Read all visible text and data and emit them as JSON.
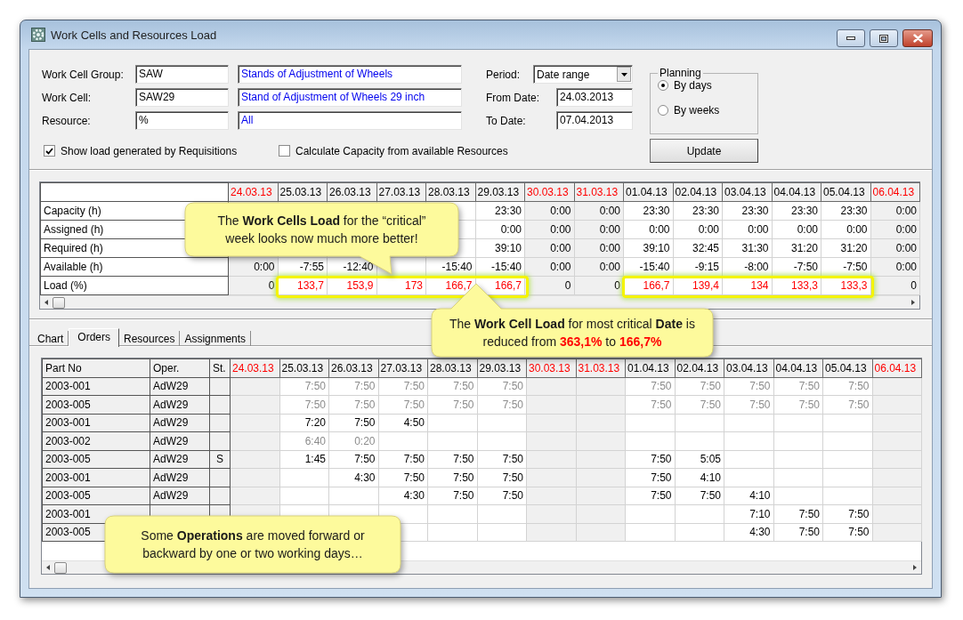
{
  "window": {
    "title": "Work Cells and Resources Load"
  },
  "filters": {
    "fields": [
      {
        "label": "Work Cell Group:",
        "code": "SAW",
        "description": "Stands of Adjustment of Wheels"
      },
      {
        "label": "Work Cell:",
        "code": "SAW29",
        "description": "Stand of Adjustment of Wheels 29 inch"
      },
      {
        "label": "Resource:",
        "code": "%",
        "description": "All"
      }
    ],
    "period": {
      "label": "Period:",
      "value": "Date range"
    },
    "from_date": {
      "label": "From Date:",
      "value": "24.03.2013"
    },
    "to_date": {
      "label": "To Date:",
      "value": "07.04.2013"
    },
    "checkboxes": [
      {
        "label": "Show load generated by Requisitions",
        "checked": true
      },
      {
        "label": "Calculate Capacity from available Resources",
        "checked": false
      }
    ],
    "planning": {
      "title": "Planning",
      "options": [
        {
          "label": "By days",
          "selected": true
        },
        {
          "label": "By weeks",
          "selected": false
        }
      ]
    },
    "update_button": "Update"
  },
  "load_grid": {
    "columns": [
      {
        "label": "24.03.13",
        "weekend": true
      },
      {
        "label": "25.03.13",
        "weekend": false
      },
      {
        "label": "26.03.13",
        "weekend": false
      },
      {
        "label": "27.03.13",
        "weekend": false
      },
      {
        "label": "28.03.13",
        "weekend": false
      },
      {
        "label": "29.03.13",
        "weekend": false
      },
      {
        "label": "30.03.13",
        "weekend": true
      },
      {
        "label": "31.03.13",
        "weekend": true
      },
      {
        "label": "01.04.13",
        "weekend": false
      },
      {
        "label": "02.04.13",
        "weekend": false
      },
      {
        "label": "03.04.13",
        "weekend": false
      },
      {
        "label": "04.04.13",
        "weekend": false
      },
      {
        "label": "05.04.13",
        "weekend": false
      },
      {
        "label": "06.04.13",
        "weekend": true
      }
    ],
    "rows": [
      {
        "label": "Capacity (h)",
        "values": [
          {
            "kind": "blank"
          },
          {
            "kind": "blank"
          },
          {
            "kind": "blank"
          },
          {
            "kind": "blank"
          },
          {
            "kind": "blank"
          },
          {
            "kind": "value",
            "text": "23:30"
          },
          {
            "kind": "value",
            "text": "0:00"
          },
          {
            "kind": "value",
            "text": "0:00"
          },
          {
            "kind": "value",
            "text": "23:30"
          },
          {
            "kind": "value",
            "text": "23:30"
          },
          {
            "kind": "value",
            "text": "23:30"
          },
          {
            "kind": "value",
            "text": "23:30"
          },
          {
            "kind": "value",
            "text": "23:30"
          },
          {
            "kind": "value",
            "text": "0:00"
          }
        ]
      },
      {
        "label": "Assigned (h)",
        "values": [
          {
            "kind": "blank"
          },
          {
            "kind": "blank"
          },
          {
            "kind": "blank"
          },
          {
            "kind": "blank"
          },
          {
            "kind": "blank"
          },
          {
            "kind": "value",
            "text": "0:00"
          },
          {
            "kind": "value",
            "text": "0:00"
          },
          {
            "kind": "value",
            "text": "0:00"
          },
          {
            "kind": "value",
            "text": "0:00"
          },
          {
            "kind": "value",
            "text": "0:00"
          },
          {
            "kind": "value",
            "text": "0:00"
          },
          {
            "kind": "value",
            "text": "0:00"
          },
          {
            "kind": "value",
            "text": "0:00"
          },
          {
            "kind": "value",
            "text": "0:00"
          }
        ]
      },
      {
        "label": "Required (h)",
        "values": [
          {
            "kind": "blank"
          },
          {
            "kind": "blank"
          },
          {
            "kind": "blank"
          },
          {
            "kind": "blank"
          },
          {
            "kind": "blank"
          },
          {
            "kind": "value",
            "text": "39:10"
          },
          {
            "kind": "value",
            "text": "0:00"
          },
          {
            "kind": "value",
            "text": "0:00"
          },
          {
            "kind": "value",
            "text": "39:10"
          },
          {
            "kind": "value",
            "text": "32:45"
          },
          {
            "kind": "value",
            "text": "31:30"
          },
          {
            "kind": "value",
            "text": "31:20"
          },
          {
            "kind": "value",
            "text": "31:20"
          },
          {
            "kind": "value",
            "text": "0:00"
          }
        ]
      },
      {
        "label": "Available (h)",
        "values": [
          {
            "kind": "value",
            "text": "0:00"
          },
          {
            "kind": "value",
            "text": "-7:55"
          },
          {
            "kind": "value",
            "text": "-12:40"
          },
          {
            "kind": "blank"
          },
          {
            "kind": "value",
            "text": "-15:40"
          },
          {
            "kind": "value",
            "text": "-15:40"
          },
          {
            "kind": "value",
            "text": "0:00"
          },
          {
            "kind": "value",
            "text": "0:00"
          },
          {
            "kind": "value",
            "text": "-15:40"
          },
          {
            "kind": "value",
            "text": "-9:15"
          },
          {
            "kind": "value",
            "text": "-8:00"
          },
          {
            "kind": "value",
            "text": "-7:50"
          },
          {
            "kind": "value",
            "text": "-7:50"
          },
          {
            "kind": "value",
            "text": "0:00"
          }
        ]
      },
      {
        "label": "Load (%)",
        "values": [
          {
            "kind": "value",
            "text": "0",
            "over": false,
            "framed": false
          },
          {
            "kind": "value",
            "text": "133,7",
            "over": true,
            "framed": true
          },
          {
            "kind": "value",
            "text": "153,9",
            "over": true,
            "framed": true
          },
          {
            "kind": "value",
            "text": "173",
            "over": true,
            "framed": true
          },
          {
            "kind": "value",
            "text": "166,7",
            "over": true,
            "framed": true
          },
          {
            "kind": "value",
            "text": "166,7",
            "over": true,
            "framed": true
          },
          {
            "kind": "value",
            "text": "0",
            "over": false,
            "framed": false
          },
          {
            "kind": "value",
            "text": "0",
            "over": false,
            "framed": false
          },
          {
            "kind": "value",
            "text": "166,7",
            "over": true,
            "framed": true
          },
          {
            "kind": "value",
            "text": "139,4",
            "over": true,
            "framed": true
          },
          {
            "kind": "value",
            "text": "134",
            "over": true,
            "framed": true
          },
          {
            "kind": "value",
            "text": "133,3",
            "over": true,
            "framed": true
          },
          {
            "kind": "value",
            "text": "133,3",
            "over": true,
            "framed": true
          },
          {
            "kind": "value",
            "text": "0",
            "over": false,
            "framed": false
          }
        ]
      }
    ]
  },
  "tabs": [
    {
      "label": "Chart",
      "selected": false
    },
    {
      "label": "Orders",
      "selected": true
    },
    {
      "label": "Resources",
      "selected": false
    },
    {
      "label": "Assignments",
      "selected": false
    }
  ],
  "orders_grid": {
    "headers": [
      "Part No",
      "Oper.",
      "St."
    ],
    "columns": [
      {
        "label": "24.03.13",
        "weekend": true
      },
      {
        "label": "25.03.13",
        "weekend": false
      },
      {
        "label": "26.03.13",
        "weekend": false
      },
      {
        "label": "27.03.13",
        "weekend": false
      },
      {
        "label": "28.03.13",
        "weekend": false
      },
      {
        "label": "29.03.13",
        "weekend": false
      },
      {
        "label": "30.03.13",
        "weekend": true
      },
      {
        "label": "31.03.13",
        "weekend": true
      },
      {
        "label": "01.04.13",
        "weekend": false
      },
      {
        "label": "02.04.13",
        "weekend": false
      },
      {
        "label": "03.04.13",
        "weekend": false
      },
      {
        "label": "04.04.13",
        "weekend": false
      },
      {
        "label": "05.04.13",
        "weekend": false
      },
      {
        "label": "06.04.13",
        "weekend": true
      }
    ],
    "rows": [
      {
        "part_no": "2003-001",
        "oper": "AdW29",
        "greyed": true,
        "values": [
          {
            "kind": "blank"
          },
          {
            "kind": "value",
            "text": "7:50"
          },
          {
            "kind": "value",
            "text": "7:50"
          },
          {
            "kind": "value",
            "text": "7:50"
          },
          {
            "kind": "value",
            "text": "7:50"
          },
          {
            "kind": "value",
            "text": "7:50"
          },
          {
            "kind": "blank"
          },
          {
            "kind": "blank"
          },
          {
            "kind": "value",
            "text": "7:50"
          },
          {
            "kind": "value",
            "text": "7:50"
          },
          {
            "kind": "value",
            "text": "7:50"
          },
          {
            "kind": "value",
            "text": "7:50"
          },
          {
            "kind": "value",
            "text": "7:50"
          },
          {
            "kind": "blank"
          }
        ]
      },
      {
        "part_no": "2003-005",
        "oper": "AdW29",
        "greyed": true,
        "values": [
          {
            "kind": "blank"
          },
          {
            "kind": "value",
            "text": "7:50"
          },
          {
            "kind": "value",
            "text": "7:50"
          },
          {
            "kind": "value",
            "text": "7:50"
          },
          {
            "kind": "value",
            "text": "7:50"
          },
          {
            "kind": "value",
            "text": "7:50"
          },
          {
            "kind": "blank"
          },
          {
            "kind": "blank"
          },
          {
            "kind": "value",
            "text": "7:50"
          },
          {
            "kind": "value",
            "text": "7:50"
          },
          {
            "kind": "value",
            "text": "7:50"
          },
          {
            "kind": "value",
            "text": "7:50"
          },
          {
            "kind": "value",
            "text": "7:50"
          },
          {
            "kind": "blank"
          }
        ]
      },
      {
        "part_no": "2003-001",
        "oper": "AdW29",
        "greyed": false,
        "values": [
          {
            "kind": "blank"
          },
          {
            "kind": "value",
            "text": "7:20"
          },
          {
            "kind": "value",
            "text": "7:50"
          },
          {
            "kind": "value",
            "text": "4:50"
          },
          {
            "kind": "blank"
          },
          {
            "kind": "blank"
          },
          {
            "kind": "blank"
          },
          {
            "kind": "blank"
          },
          {
            "kind": "blank"
          },
          {
            "kind": "blank"
          },
          {
            "kind": "blank"
          },
          {
            "kind": "blank"
          },
          {
            "kind": "blank"
          },
          {
            "kind": "blank"
          }
        ]
      },
      {
        "part_no": "2003-002",
        "oper": "AdW29",
        "greyed": true,
        "values": [
          {
            "kind": "blank"
          },
          {
            "kind": "value",
            "text": "6:40"
          },
          {
            "kind": "value",
            "text": "0:20"
          },
          {
            "kind": "blank"
          },
          {
            "kind": "blank"
          },
          {
            "kind": "blank"
          },
          {
            "kind": "blank"
          },
          {
            "kind": "blank"
          },
          {
            "kind": "blank"
          },
          {
            "kind": "blank"
          },
          {
            "kind": "blank"
          },
          {
            "kind": "blank"
          },
          {
            "kind": "blank"
          },
          {
            "kind": "blank"
          }
        ]
      },
      {
        "part_no": "2003-005",
        "oper": "AdW29",
        "st": "S",
        "greyed": false,
        "values": [
          {
            "kind": "blank"
          },
          {
            "kind": "value",
            "text": "1:45"
          },
          {
            "kind": "value",
            "text": "7:50"
          },
          {
            "kind": "value",
            "text": "7:50"
          },
          {
            "kind": "value",
            "text": "7:50"
          },
          {
            "kind": "value",
            "text": "7:50"
          },
          {
            "kind": "blank"
          },
          {
            "kind": "blank"
          },
          {
            "kind": "value",
            "text": "7:50"
          },
          {
            "kind": "value",
            "text": "5:05"
          },
          {
            "kind": "blank"
          },
          {
            "kind": "blank"
          },
          {
            "kind": "blank"
          },
          {
            "kind": "blank"
          }
        ]
      },
      {
        "part_no": "2003-001",
        "oper": "AdW29",
        "greyed": false,
        "values": [
          {
            "kind": "blank"
          },
          {
            "kind": "blank"
          },
          {
            "kind": "value",
            "text": "4:30"
          },
          {
            "kind": "value",
            "text": "7:50"
          },
          {
            "kind": "value",
            "text": "7:50"
          },
          {
            "kind": "value",
            "text": "7:50"
          },
          {
            "kind": "blank"
          },
          {
            "kind": "blank"
          },
          {
            "kind": "value",
            "text": "7:50"
          },
          {
            "kind": "value",
            "text": "4:10"
          },
          {
            "kind": "blank"
          },
          {
            "kind": "blank"
          },
          {
            "kind": "blank"
          },
          {
            "kind": "blank"
          }
        ]
      },
      {
        "part_no": "2003-005",
        "oper": "AdW29",
        "greyed": false,
        "values": [
          {
            "kind": "blank"
          },
          {
            "kind": "blank"
          },
          {
            "kind": "blank"
          },
          {
            "kind": "value",
            "text": "4:30"
          },
          {
            "kind": "value",
            "text": "7:50"
          },
          {
            "kind": "value",
            "text": "7:50"
          },
          {
            "kind": "blank"
          },
          {
            "kind": "blank"
          },
          {
            "kind": "value",
            "text": "7:50"
          },
          {
            "kind": "value",
            "text": "7:50"
          },
          {
            "kind": "value",
            "text": "4:10"
          },
          {
            "kind": "blank"
          },
          {
            "kind": "blank"
          },
          {
            "kind": "blank"
          }
        ]
      },
      {
        "part_no": "2003-001",
        "greyed": false,
        "values": [
          {
            "kind": "blank"
          },
          {
            "kind": "blank"
          },
          {
            "kind": "blank"
          },
          {
            "kind": "blank"
          },
          {
            "kind": "blank"
          },
          {
            "kind": "blank"
          },
          {
            "kind": "blank"
          },
          {
            "kind": "blank"
          },
          {
            "kind": "blank"
          },
          {
            "kind": "blank"
          },
          {
            "kind": "value",
            "text": "7:10"
          },
          {
            "kind": "value",
            "text": "7:50"
          },
          {
            "kind": "value",
            "text": "7:50"
          },
          {
            "kind": "blank"
          }
        ]
      },
      {
        "part_no": "2003-005",
        "greyed": false,
        "values": [
          {
            "kind": "blank"
          },
          {
            "kind": "blank"
          },
          {
            "kind": "blank"
          },
          {
            "kind": "blank"
          },
          {
            "kind": "blank"
          },
          {
            "kind": "blank"
          },
          {
            "kind": "blank"
          },
          {
            "kind": "blank"
          },
          {
            "kind": "blank"
          },
          {
            "kind": "blank"
          },
          {
            "kind": "value",
            "text": "4:30"
          },
          {
            "kind": "value",
            "text": "7:50"
          },
          {
            "kind": "value",
            "text": "7:50"
          },
          {
            "kind": "blank"
          }
        ]
      }
    ]
  },
  "callouts": [
    {
      "segments": [
        {
          "text": "The ",
          "kind": "plain"
        },
        {
          "text": "Work Cells Load",
          "kind": "strong"
        },
        {
          "text": " for the “critical” week looks now much more better!",
          "kind": "plain"
        }
      ]
    },
    {
      "segments": [
        {
          "text": "The ",
          "kind": "plain"
        },
        {
          "text": "Work Cell Load",
          "kind": "strong"
        },
        {
          "text": " for most critical ",
          "kind": "plain"
        },
        {
          "text": "Date",
          "kind": "strong"
        },
        {
          "text": " is reduced from ",
          "kind": "plain"
        },
        {
          "text": "363,1%",
          "kind": "alert"
        },
        {
          "text": " to ",
          "kind": "plain"
        },
        {
          "text": "166,7%",
          "kind": "alert"
        }
      ]
    },
    {
      "segments": [
        {
          "text": "Some ",
          "kind": "plain"
        },
        {
          "text": "Operations",
          "kind": "strong"
        },
        {
          "text": " are moved forward or backward by one or two working days…",
          "kind": "plain"
        }
      ]
    }
  ]
}
